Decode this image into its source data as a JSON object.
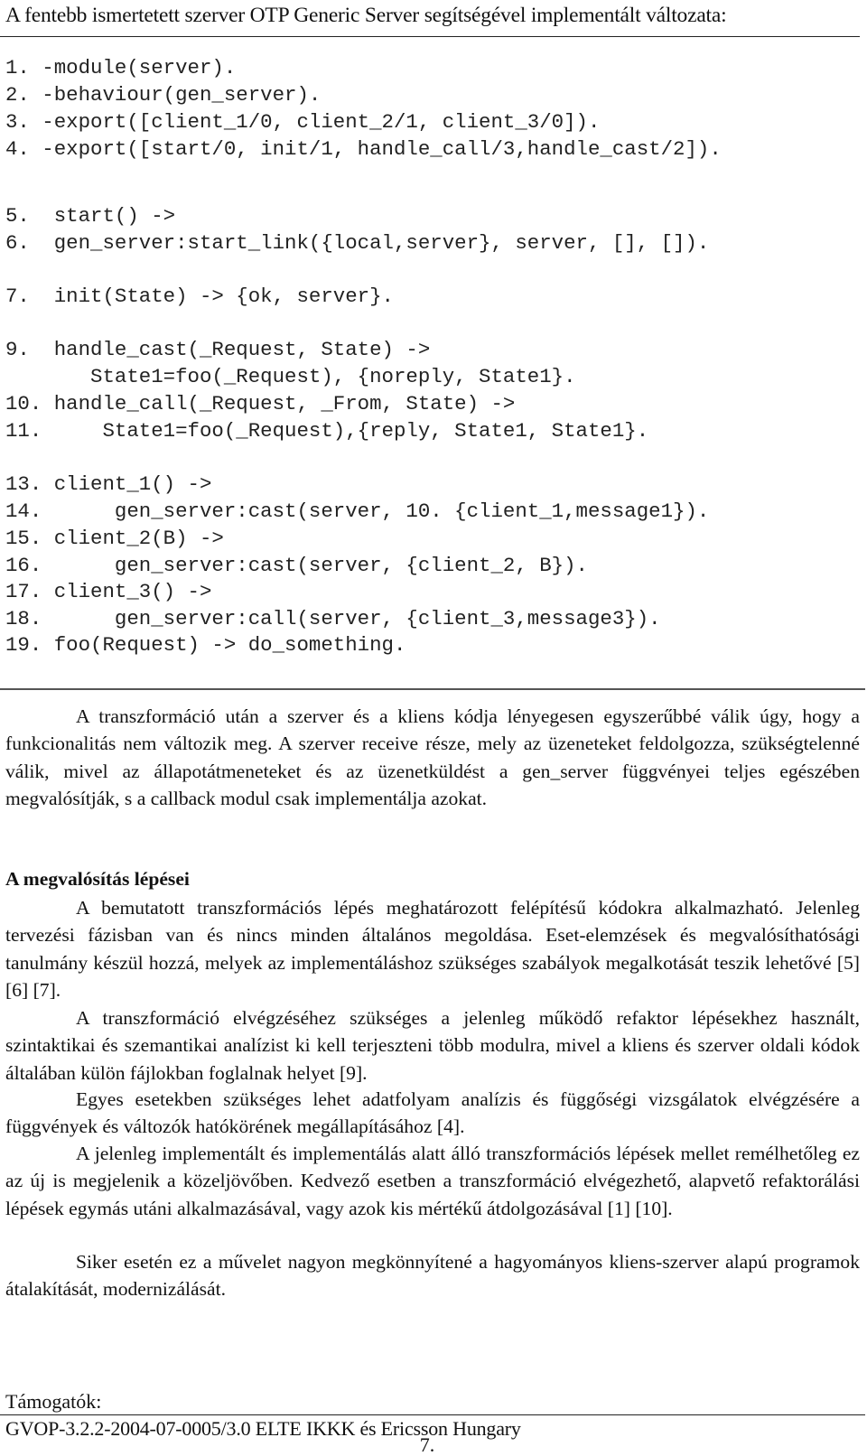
{
  "header": {
    "title": "A fentebb ismertetett szerver OTP Generic Server segítségével implementált változata:"
  },
  "code": {
    "lines": [
      "1. -module(server).",
      "2. -behaviour(gen_server).",
      "3. -export([client_1/0, client_2/1, client_3/0]).",
      "4. -export([start/0, init/1, handle_call/3,handle_cast/2]).",
      "5.  start() ->",
      "6.  gen_server:start_link({local,server}, server, [], []).",
      "7.  init(State) -> {ok, server}.",
      "9.  handle_cast(_Request, State) ->",
      "       State1=foo(_Request), {noreply, State1}.",
      "10. handle_call(_Request, _From, State) ->",
      "11.     State1=foo(_Request),{reply, State1, State1}.",
      "13. client_1() ->",
      "14.      gen_server:cast(server, 10. {client_1,message1}).",
      "15. client_2(B) ->",
      "16.      gen_server:cast(server, {client_2, B}).",
      "17. client_3() ->",
      "18.      gen_server:call(server, {client_3,message3}).",
      "19. foo(Request) -> do_something."
    ]
  },
  "body": {
    "intro_paragraph": "A transzformáció után a szerver és a kliens kódja lényegesen egyszerűbbé válik úgy, hogy a funkcionalitás nem változik meg. A szerver receive része, mely az üzeneteket feldolgozza, szükségtelenné válik, mivel az állapotátmeneteket és az üzenetküldést a gen_server függvényei teljes egészében megvalósítják, s a callback modul csak implementálja azokat.",
    "section_heading": "A megvalósítás lépései",
    "paragraphs": [
      "A bemutatott transzformációs lépés meghatározott felépítésű kódokra alkalmazható. Jelenleg tervezési fázisban van és nincs minden általános megoldása. Eset-elemzések és megvalósíthatósági tanulmány készül hozzá, melyek az implementáláshoz szükséges szabályok megalkotását teszik lehetővé [5] [6] [7].",
      "A transzformáció elvégzéséhez szükséges a jelenleg működő refaktor lépésekhez használt, szintaktikai és szemantikai analízist ki kell terjeszteni több modulra, mivel a kliens és szerver oldali kódok általában külön fájlokban foglalnak helyet [9].",
      "Egyes esetekben szükséges lehet adatfolyam analízis és függőségi vizsgálatok elvégzésére a függvények és változók hatókörének megállapításához [4].",
      "A jelenleg implementált és implementálás alatt álló transzformációs lépések mellet remélhetőleg ez az új is megjelenik a közeljövőben. Kedvező esetben a transzformáció elvégezhető, alapvető refaktorálási lépések egymás utáni alkalmazásával, vagy azok kis mértékű átdolgozásával [1] [10].",
      "Siker esetén ez a művelet nagyon megkönnyítené a hagyományos kliens-szerver alapú programok átalakítását, modernizálását."
    ]
  },
  "footer": {
    "supporters_label": "Támogatók:",
    "supporters_text": "GVOP-3.2.2-2004-07-0005/3.0 ELTE IKKK és Ericsson Hungary",
    "page_number": "7."
  }
}
